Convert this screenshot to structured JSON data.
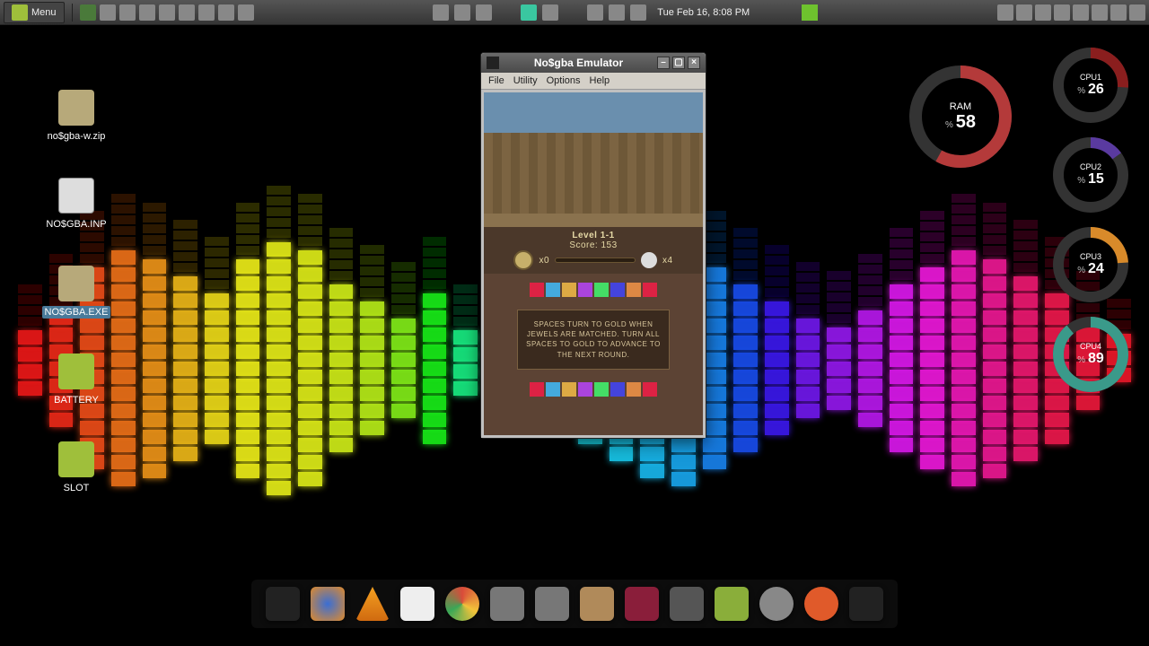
{
  "panel": {
    "menu_label": "Menu",
    "clock": "Tue Feb 16,  8:08 PM"
  },
  "desktop": {
    "icons": [
      {
        "name": "no$gba-w.zip",
        "kind": "pkg"
      },
      {
        "name": "NO$GBA.INP",
        "kind": "file"
      },
      {
        "name": "NO$GBA.EXE",
        "kind": "exe",
        "selected": true
      },
      {
        "name": "BATTERY",
        "kind": "folder"
      },
      {
        "name": "SLOT",
        "kind": "folder"
      }
    ]
  },
  "window": {
    "title": "No$gba Emulator",
    "menus": [
      "File",
      "Utility",
      "Options",
      "Help"
    ],
    "game": {
      "level_label": "Level 1-1",
      "score_label": "Score: 153",
      "coins": "x0",
      "lives": "x4",
      "message": "SPACES TURN TO GOLD WHEN JEWELS ARE MATCHED. TURN ALL SPACES TO GOLD TO ADVANCE TO THE NEXT ROUND."
    }
  },
  "gauges": {
    "ram": {
      "label": "RAM",
      "value": 58,
      "color": "#b43a3a"
    },
    "cpu1": {
      "label": "CPU1",
      "value": 26,
      "color": "#8a1e1e"
    },
    "cpu2": {
      "label": "CPU2",
      "value": 15,
      "color": "#5a3aa0"
    },
    "cpu3": {
      "label": "CPU3",
      "value": 24,
      "color": "#d88a2a"
    },
    "cpu4": {
      "label": "CPU4",
      "value": 89,
      "color": "#3a9a8a"
    }
  },
  "eq": {
    "heights": [
      4,
      7,
      12,
      14,
      13,
      11,
      9,
      13,
      15,
      14,
      10,
      8,
      6,
      9,
      4,
      3,
      5,
      7,
      9,
      11,
      13,
      14,
      12,
      10,
      8,
      6,
      5,
      7,
      10,
      12,
      14,
      13,
      11,
      9,
      5,
      3
    ],
    "hues": [
      0,
      5,
      15,
      25,
      35,
      45,
      55,
      60,
      62,
      64,
      68,
      75,
      90,
      120,
      150,
      168,
      175,
      180,
      185,
      190,
      195,
      200,
      210,
      225,
      250,
      265,
      275,
      285,
      295,
      305,
      315,
      325,
      335,
      345,
      350,
      355
    ]
  }
}
